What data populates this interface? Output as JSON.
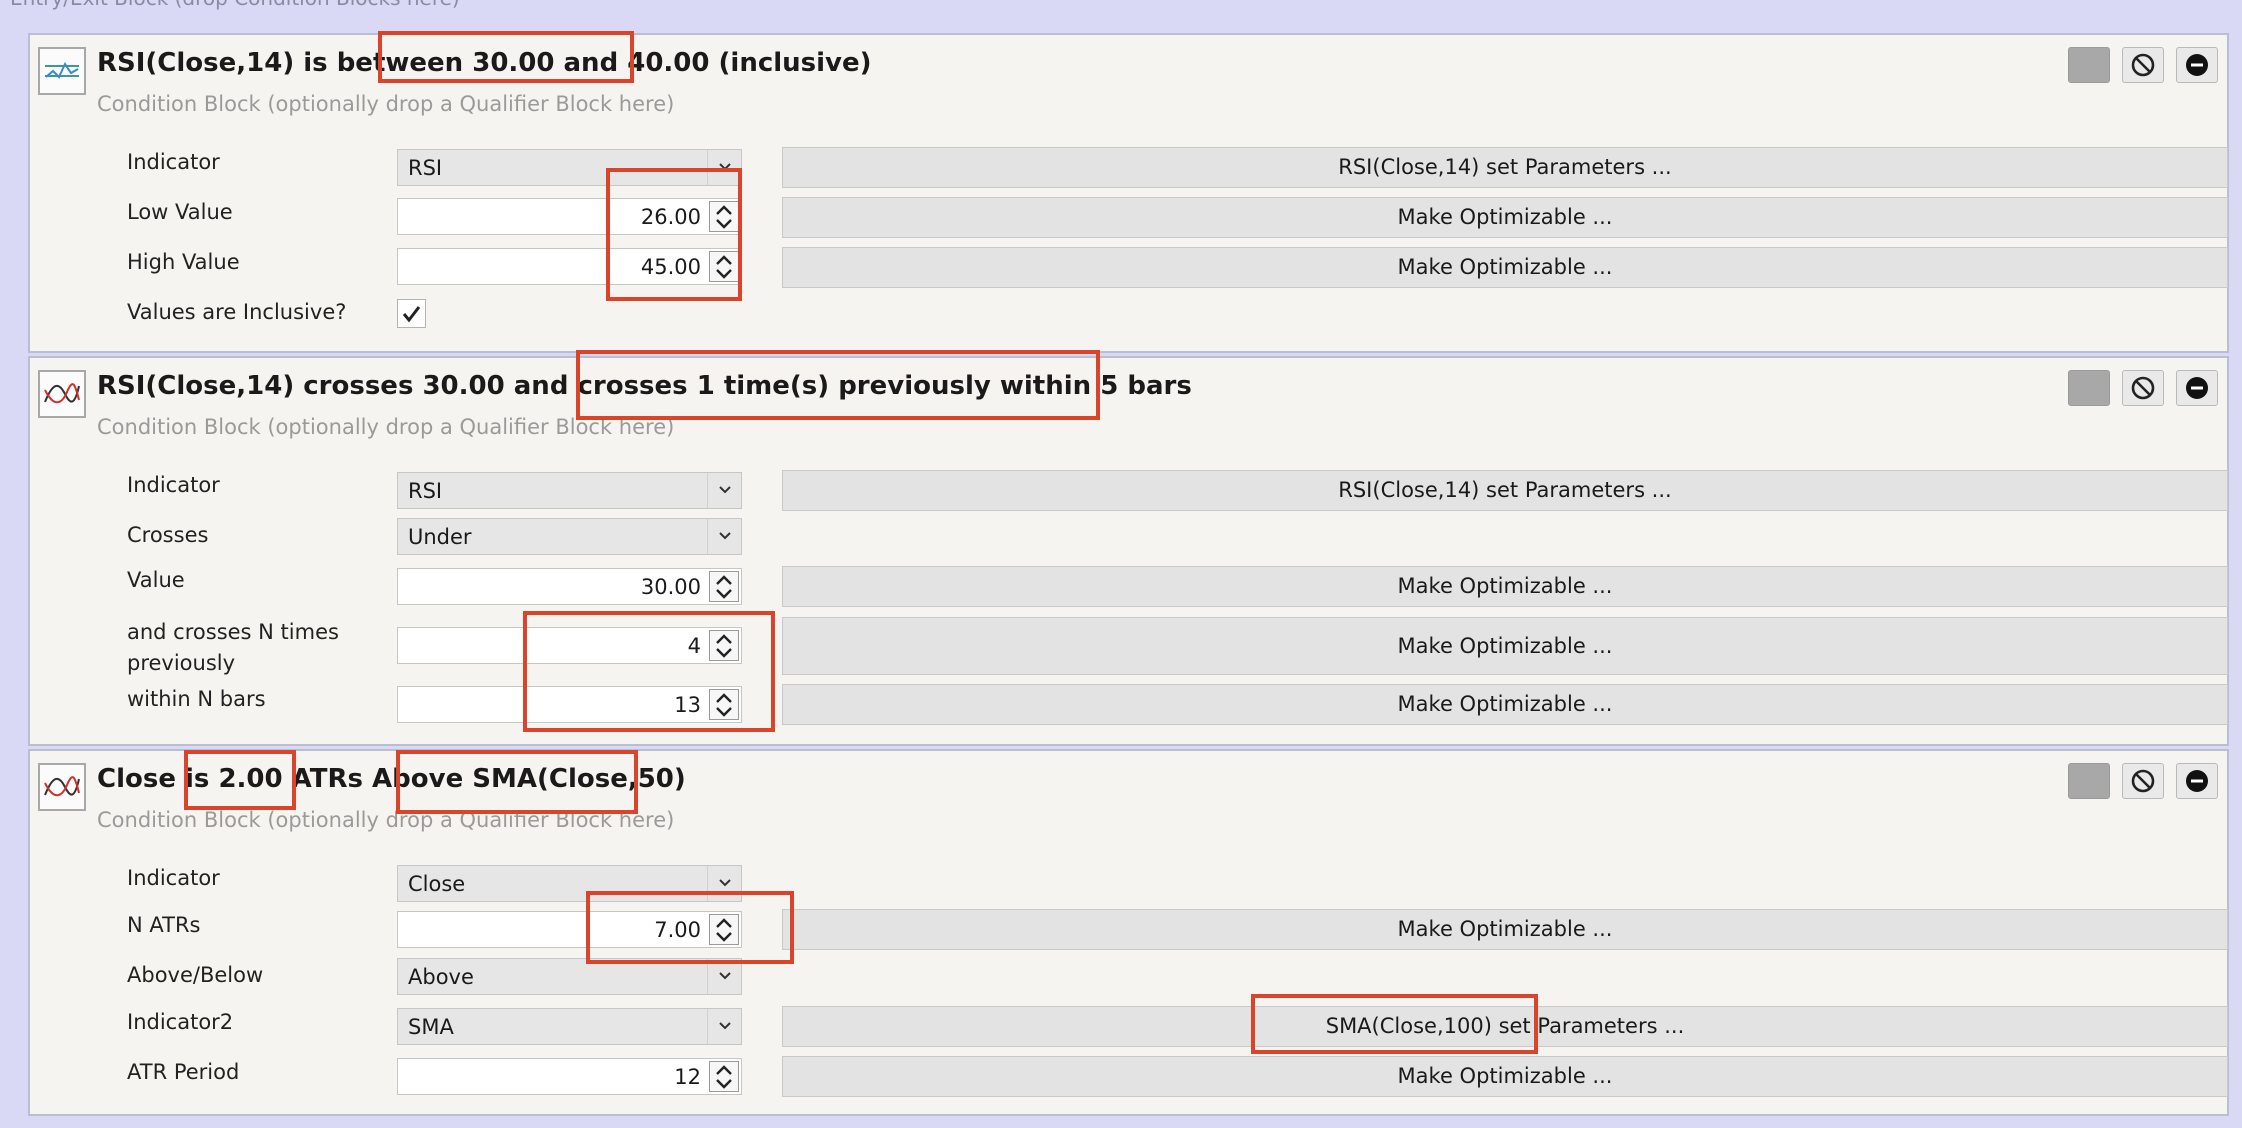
{
  "page": {
    "header_text": "Entry/Exit Block (drop Condition Blocks here)"
  },
  "colors": {
    "highlight": "#d9442b",
    "block_bg": "#f5f4f0",
    "page_bg": "#d9d9f5"
  },
  "header_buttons": {
    "swatch": "color-swatch",
    "disable": "no-entry-icon",
    "remove": "minus-circle-icon"
  },
  "blocks": [
    {
      "icon": "indicator-between-icon",
      "title": "RSI(Close,14) is between 30.00 and 40.00 (inclusive)",
      "subtitle": "Condition Block (optionally drop a Qualifier Block here)",
      "rows": [
        {
          "label": "Indicator",
          "control": "dropdown",
          "value": "RSI",
          "button": "RSI(Close,14) set Parameters ..."
        },
        {
          "label": "Low Value",
          "control": "spin",
          "value": "26.00",
          "button": "Make Optimizable ..."
        },
        {
          "label": "High Value",
          "control": "spin",
          "value": "45.00",
          "button": "Make Optimizable ..."
        },
        {
          "label": "Values are Inclusive?",
          "control": "checkbox",
          "checked": true
        }
      ]
    },
    {
      "icon": "indicator-crosses-icon",
      "title": "RSI(Close,14) crosses 30.00  and crosses 1 time(s) previously within 5 bars",
      "subtitle": "Condition Block (optionally drop a Qualifier Block here)",
      "rows": [
        {
          "label": "Indicator",
          "control": "dropdown",
          "value": "RSI",
          "button": "RSI(Close,14) set Parameters ..."
        },
        {
          "label": "Crosses",
          "control": "dropdown",
          "value": "Under"
        },
        {
          "label": "Value",
          "control": "spin",
          "value": "30.00",
          "button": "Make Optimizable ..."
        },
        {
          "label_line1": "and crosses N times",
          "label_line2": "previously",
          "control": "spin",
          "value": "4",
          "button": "Make Optimizable ..."
        },
        {
          "label": "within N bars",
          "control": "spin",
          "value": "13",
          "button": "Make Optimizable ..."
        }
      ]
    },
    {
      "icon": "indicator-atr-icon",
      "title": "Close is 2.00 ATRs Above SMA(Close,50)",
      "subtitle": "Condition Block (optionally drop a Qualifier Block here)",
      "rows": [
        {
          "label": "Indicator",
          "control": "dropdown",
          "value": "Close"
        },
        {
          "label": "N ATRs",
          "control": "spin",
          "value": "7.00",
          "button": "Make Optimizable ..."
        },
        {
          "label": "Above/Below",
          "control": "dropdown",
          "value": "Above"
        },
        {
          "label": "Indicator2",
          "control": "dropdown",
          "value": "SMA",
          "button": "SMA(Close,100) set Parameters ..."
        },
        {
          "label": "ATR Period",
          "control": "spin",
          "value": "12",
          "button": "Make Optimizable ..."
        }
      ]
    }
  ]
}
